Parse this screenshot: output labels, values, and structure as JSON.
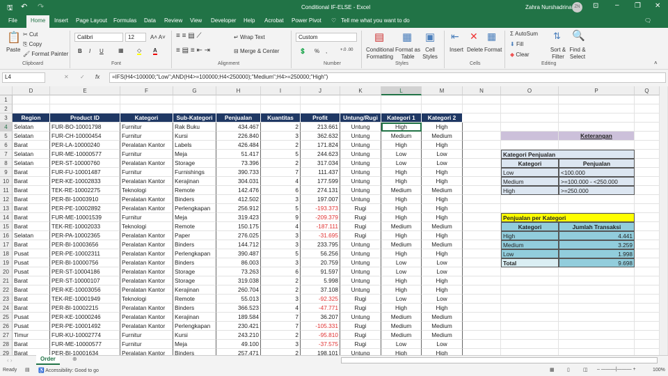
{
  "window": {
    "title": "Conditional IF-ELSE  -  Excel",
    "user": "Zahra Nurshadrina",
    "avatar": "ZN"
  },
  "tabs": [
    "File",
    "Home",
    "Insert",
    "Page Layout",
    "Formulas",
    "Data",
    "Review",
    "View",
    "Developer",
    "Help",
    "Acrobat",
    "Power Pivot"
  ],
  "tell_me": "Tell me what you want to do",
  "ribbon": {
    "paste": "Paste",
    "cut": "Cut",
    "copy": "Copy",
    "format_painter": "Format Painter",
    "clipboard": "Clipboard",
    "font_name": "Calibri",
    "font_size": "12",
    "bold": "B",
    "italic": "I",
    "underline": "U",
    "font": "Font",
    "wrap_text": "Wrap Text",
    "merge_center": "Merge & Center",
    "alignment": "Alignment",
    "number_format": "Custom",
    "percent": "%",
    "comma": ",",
    "number": "Number",
    "conditional_formatting": "Conditional Formatting",
    "format_as_table": "Format as Table",
    "cell_styles": "Cell Styles",
    "styles": "Styles",
    "insert": "Insert",
    "delete": "Delete",
    "format": "Format",
    "cells": "Cells",
    "autosum": "AutoSum",
    "fill": "Fill",
    "clear": "Clear",
    "sort_filter": "Sort & Filter",
    "find_select": "Find & Select",
    "editing": "Editing"
  },
  "formula_bar": {
    "name_box": "L4",
    "fx": "fx",
    "formula": "=IFS(H4<100000;\"Low\";AND(H4>=100000;H4<250000);\"Medium\";H4>=250000;\"High\")"
  },
  "columns": [
    "D",
    "E",
    "F",
    "G",
    "H",
    "I",
    "J",
    "K",
    "L",
    "M",
    "N",
    "O",
    "P",
    "Q"
  ],
  "table": {
    "headers": [
      "Region",
      "Product ID",
      "Kategori",
      "Sub-Kategori",
      "Penjualan",
      "Kuantitas",
      "Profit",
      "Untung/Rugi",
      "Kategori 1",
      "Kategori 2"
    ],
    "rows": [
      [
        "Selatan",
        "FUR-BO-10001798",
        "Furnitur",
        "Rak Buku",
        "434.467",
        "2",
        "213.661",
        "Untung",
        "High",
        "High"
      ],
      [
        "Selatan",
        "FUR-CH-10000454",
        "Furnitur",
        "Kursi",
        "226.840",
        "3",
        "362.632",
        "Untung",
        "Medium",
        "Medium"
      ],
      [
        "Barat",
        "PER-LA-10000240",
        "Peralatan Kantor",
        "Labels",
        "426.484",
        "2",
        "171.824",
        "Untung",
        "High",
        "High"
      ],
      [
        "Selatan",
        "FUR-ME-10000577",
        "Furnitur",
        "Meja",
        "51.417",
        "5",
        "244.623",
        "Untung",
        "Low",
        "Low"
      ],
      [
        "Selatan",
        "PER-ST-10000760",
        "Peralatan Kantor",
        "Storage",
        "73.396",
        "2",
        "317.034",
        "Untung",
        "Low",
        "Low"
      ],
      [
        "Barat",
        "FUR-FU-10001487",
        "Furnitur",
        "Furnishings",
        "390.733",
        "7",
        "111.437",
        "Untung",
        "High",
        "High"
      ],
      [
        "Barat",
        "PER-KE-10002833",
        "Peralatan Kantor",
        "Kerajinan",
        "304.031",
        "4",
        "177.599",
        "Untung",
        "High",
        "High"
      ],
      [
        "Barat",
        "TEK-RE-10002275",
        "Teknologi",
        "Remote",
        "142.476",
        "6",
        "274.131",
        "Untung",
        "Medium",
        "Medium"
      ],
      [
        "Barat",
        "PER-BI-10003910",
        "Peralatan Kantor",
        "Binders",
        "412.502",
        "3",
        "197.007",
        "Untung",
        "High",
        "High"
      ],
      [
        "Barat",
        "PER-PE-10002892",
        "Peralatan Kantor",
        "Perlengkapan",
        "256.912",
        "5",
        "-193.373",
        "Rugi",
        "High",
        "High"
      ],
      [
        "Barat",
        "FUR-ME-10001539",
        "Furnitur",
        "Meja",
        "319.423",
        "9",
        "-209.379",
        "Rugi",
        "High",
        "High"
      ],
      [
        "Barat",
        "TEK-RE-10002033",
        "Teknologi",
        "Remote",
        "150.175",
        "4",
        "-187.111",
        "Rugi",
        "Medium",
        "Medium"
      ],
      [
        "Selatan",
        "PER-PA-10002365",
        "Peralatan Kantor",
        "Paper",
        "276.025",
        "3",
        "-31.695",
        "Rugi",
        "High",
        "High"
      ],
      [
        "Barat",
        "PER-BI-10003656",
        "Peralatan Kantor",
        "Binders",
        "144.712",
        "3",
        "233.795",
        "Untung",
        "Medium",
        "Medium"
      ],
      [
        "Pusat",
        "PER-PE-10002311",
        "Peralatan Kantor",
        "Perlengkapan",
        "390.487",
        "5",
        "56.256",
        "Untung",
        "High",
        "High"
      ],
      [
        "Pusat",
        "PER-BI-10000756",
        "Peralatan Kantor",
        "Binders",
        "86.003",
        "3",
        "20.759",
        "Untung",
        "Low",
        "Low"
      ],
      [
        "Pusat",
        "PER-ST-10004186",
        "Peralatan Kantor",
        "Storage",
        "73.263",
        "6",
        "91.597",
        "Untung",
        "Low",
        "Low"
      ],
      [
        "Barat",
        "PER-ST-10000107",
        "Peralatan Kantor",
        "Storage",
        "319.038",
        "2",
        "5.998",
        "Untung",
        "High",
        "High"
      ],
      [
        "Barat",
        "PER-KE-10003056",
        "Peralatan Kantor",
        "Kerajinan",
        "260.704",
        "2",
        "37.108",
        "Untung",
        "High",
        "High"
      ],
      [
        "Barat",
        "TEK-RE-10001949",
        "Teknologi",
        "Remote",
        "55.013",
        "3",
        "-92.325",
        "Rugi",
        "Low",
        "Low"
      ],
      [
        "Barat",
        "PER-BI-10002215",
        "Peralatan Kantor",
        "Binders",
        "366.523",
        "4",
        "-47.771",
        "Rugi",
        "High",
        "High"
      ],
      [
        "Pusat",
        "PER-KE-10000246",
        "Peralatan Kantor",
        "Kerajinan",
        "189.584",
        "7",
        "36.207",
        "Untung",
        "Medium",
        "Medium"
      ],
      [
        "Pusat",
        "PER-PE-10001492",
        "Peralatan Kantor",
        "Perlengkapan",
        "230.421",
        "7",
        "-105.331",
        "Rugi",
        "Medium",
        "Medium"
      ],
      [
        "Timur",
        "FUR-KU-10002774",
        "Furnitur",
        "Kursi",
        "243.210",
        "2",
        "-95.810",
        "Rugi",
        "Medium",
        "Medium"
      ],
      [
        "Barat",
        "FUR-ME-10000577",
        "Furnitur",
        "Meja",
        "49.100",
        "3",
        "-37.575",
        "Rugi",
        "Low",
        "Low"
      ],
      [
        "Barat",
        "PER-BI-10001634",
        "Peralatan Kantor",
        "Binders",
        "257.471",
        "2",
        "198.101",
        "Untung",
        "High",
        "High"
      ]
    ]
  },
  "keterangan": "Keterangan",
  "kategori_penjualan": {
    "title": "Kategori Penjualan",
    "headers": [
      "Kategori",
      "Penjualan"
    ],
    "rows": [
      [
        "Low",
        "<100.000"
      ],
      [
        "Medium",
        ">=100.000 - <250.000"
      ],
      [
        "High",
        ">=250.000"
      ]
    ]
  },
  "penjualan_per_kategori": {
    "title": "Penjualan per Kategori",
    "headers": [
      "Kategori",
      "Jumlah Transaksi"
    ],
    "rows": [
      [
        "High",
        "4.441"
      ],
      [
        "Medium",
        "3.259"
      ],
      [
        "Low",
        "1.998"
      ]
    ],
    "total_label": "Total",
    "total": "9.698"
  },
  "sheet_tab": "Order",
  "status": {
    "ready": "Ready",
    "accessibility": "Accessibility: Good to go",
    "zoom": "100%"
  },
  "colors": {
    "excel_green": "#217346",
    "header_navy": "#1f3864",
    "negative": "#e03030",
    "purple": "#ccc0da",
    "light_blue": "#dce6f1",
    "yellow": "#ffff00",
    "teal": "#92cddc"
  }
}
